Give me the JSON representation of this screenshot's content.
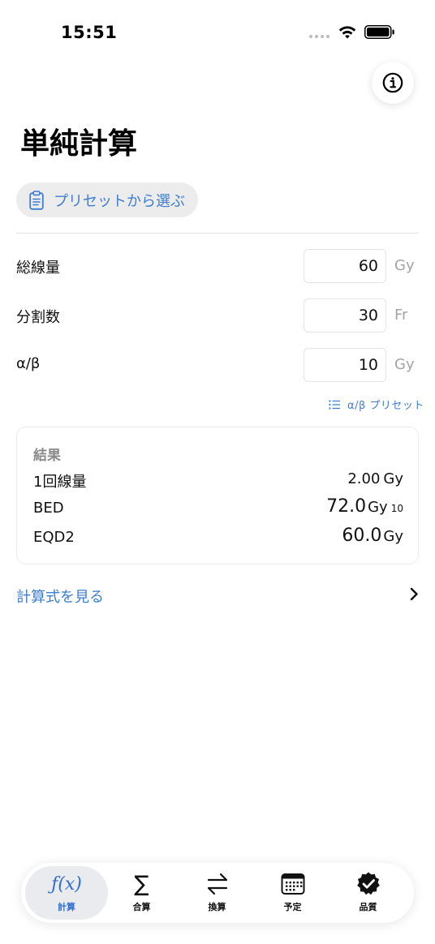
{
  "status_bar": {
    "time": "15:51"
  },
  "header": {
    "title": "単純計算"
  },
  "preset_button": {
    "label": "プリセットから選ぶ"
  },
  "inputs": [
    {
      "label": "総線量",
      "value": "60",
      "unit": "Gy"
    },
    {
      "label": "分割数",
      "value": "30",
      "unit": "Fr"
    },
    {
      "label": "α/β",
      "value": "10",
      "unit": "Gy"
    }
  ],
  "ab_preset_link": {
    "label": "α/β プリセット"
  },
  "results": {
    "title": "結果",
    "rows": [
      {
        "label": "1回線量",
        "value": "2.00",
        "unit": "Gy",
        "sub": ""
      },
      {
        "label": "BED",
        "value": "72.0",
        "unit": "Gy",
        "sub": "10"
      },
      {
        "label": "EQD2",
        "value": "60.0",
        "unit": "Gy",
        "sub": ""
      }
    ]
  },
  "formula_link": {
    "label": "計算式を見る"
  },
  "tabs": [
    {
      "label": "計算",
      "icon": "function-icon",
      "active": true
    },
    {
      "label": "合算",
      "icon": "sigma-icon",
      "active": false
    },
    {
      "label": "換算",
      "icon": "arrows-exchange-icon",
      "active": false
    },
    {
      "label": "予定",
      "icon": "calendar-icon",
      "active": false
    },
    {
      "label": "品質",
      "icon": "checkmark-seal-icon",
      "active": false
    }
  ],
  "colors": {
    "accent": "#3e7dcf",
    "tab_active": "#2f6ed0",
    "unit_gray": "#a4a4a4"
  }
}
